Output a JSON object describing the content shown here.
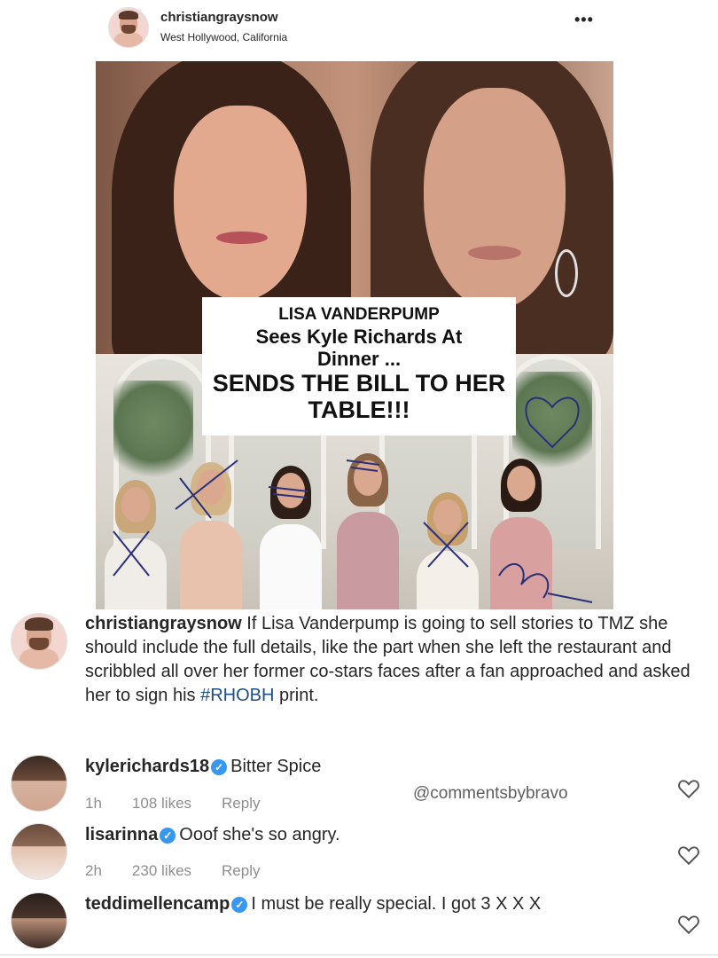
{
  "post": {
    "username": "christiangraysnow",
    "location": "West Hollywood, California",
    "more_label": "•••",
    "headline": {
      "line1": "LISA VANDERPUMP",
      "line2": "Sees Kyle Richards At",
      "line3": "Dinner ...",
      "line4": "SENDS THE BILL TO HER",
      "line5": "TABLE!!!"
    }
  },
  "caption": {
    "username": "christiangraysnow",
    "text": " If Lisa Vanderpump is going to sell stories to TMZ she should include the full details, like the part when she left the restaurant and scribbled all over her former co-stars faces after a fan approached and asked her to sign his ",
    "hashtag": "#RHOBH",
    "text_end": " print."
  },
  "watermark": "@commentsbybravo",
  "comments": [
    {
      "username": "kylerichards18",
      "verified": true,
      "text": "Bitter Spice",
      "time": "1h",
      "likes": "108 likes",
      "reply": "Reply"
    },
    {
      "username": "lisarinna",
      "verified": true,
      "text": "Ooof she's so angry.",
      "time": "2h",
      "likes": "230 likes",
      "reply": "Reply"
    },
    {
      "username": "teddimellencamp",
      "verified": true,
      "text": "I must be really special. I got 3 X X X"
    }
  ],
  "icons": {
    "verified": "verified-badge-icon",
    "like": "heart-icon",
    "more": "more-icon"
  },
  "colors": {
    "verified": "#3897f0",
    "hashtag": "#1d4f86",
    "meta": "#8e8e8e",
    "scribble": "#2a2f7a"
  }
}
